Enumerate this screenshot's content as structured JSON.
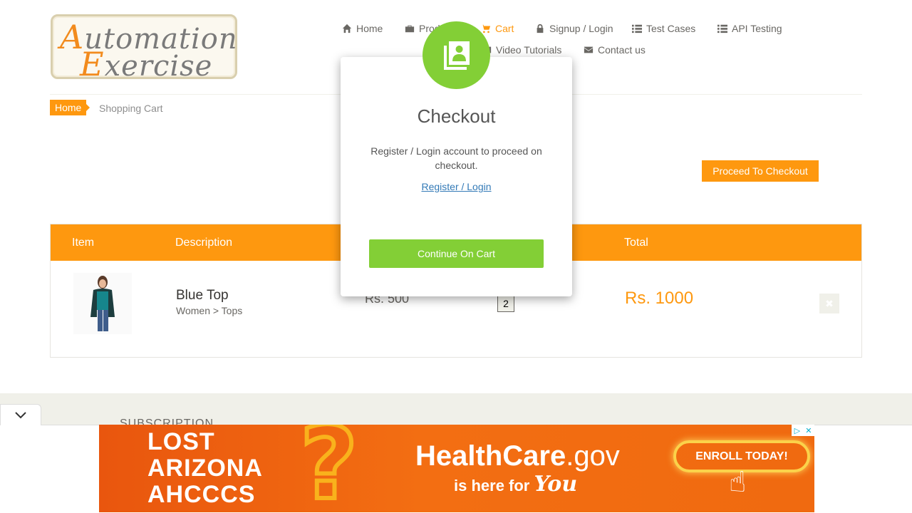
{
  "brand": {
    "word1": "Automation",
    "word2": "Exercise"
  },
  "nav": {
    "home": "Home",
    "products": "Products",
    "cart": "Cart",
    "signup_login": "Signup / Login",
    "test_cases": "Test Cases",
    "api_testing": "API Testing",
    "video_tutorials": "Video Tutorials",
    "contact_us": "Contact us"
  },
  "breadcrumb": {
    "home": "Home",
    "current": "Shopping Cart"
  },
  "proceed_button": "Proceed To Checkout",
  "table": {
    "headers": [
      "Item",
      "Description",
      "Total"
    ],
    "rows": [
      {
        "name": "Blue Top",
        "category": "Women > Tops",
        "price": "Rs. 500",
        "quantity": "2",
        "total": "Rs. 1000"
      }
    ]
  },
  "footer": {
    "subscription": "SUBSCRIPTION"
  },
  "modal": {
    "icon": "contact-book-icon",
    "title": "Checkout",
    "text": "Register / Login account to proceed on checkout.",
    "link": "Register / Login",
    "button": "Continue On Cart"
  },
  "ad": {
    "lines": [
      "LOST",
      "ARIZONA",
      "AHCCCS"
    ],
    "brand_main": "HealthCare",
    "brand_tld": ".gov",
    "tagline": "is here for",
    "tagline_em": "You",
    "cta": "ENROLL TODAY!"
  },
  "colors": {
    "accent": "#fe980f",
    "modal_green": "#83cf36",
    "link": "#337ab7"
  }
}
